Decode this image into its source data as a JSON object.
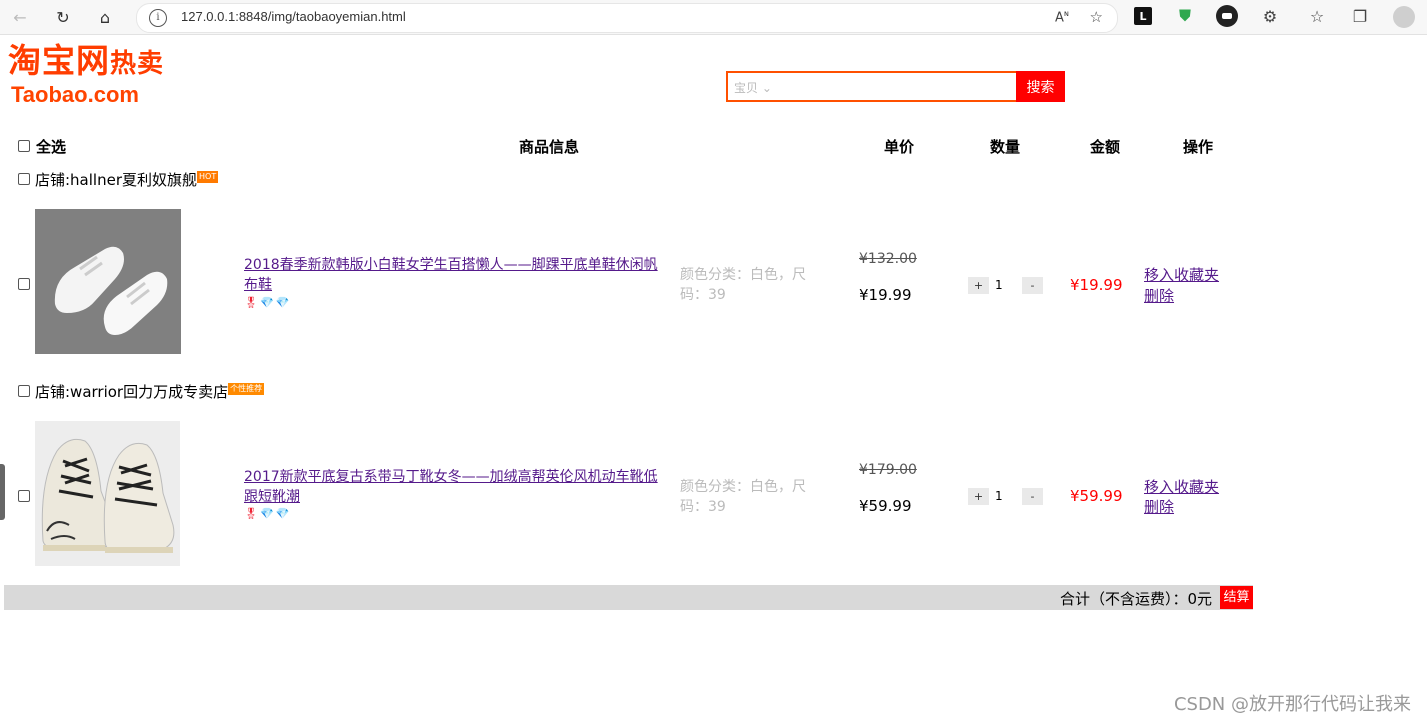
{
  "browser": {
    "url": "127.0.0.1:8848/img/taobaoyemian.html",
    "ext_letter": "L"
  },
  "logo": {
    "cn": "淘宝网",
    "suffix": "热卖",
    "en": "Taobao.com"
  },
  "search": {
    "category": "宝贝",
    "button": "搜索"
  },
  "table_header": {
    "select_all": "全选",
    "info": "商品信息",
    "unit_price": "单价",
    "quantity": "数量",
    "amount": "金额",
    "action": "操作"
  },
  "shops": [
    {
      "name": "店铺:hallner夏利奴旗舰",
      "badge": "HOT",
      "item": {
        "title": "2018春季新款韩版小白鞋女学生百搭懒人——脚踝平底单鞋休闲帆布鞋",
        "spec": "颜色分类：白色，尺码：39",
        "old_price": "¥132.00",
        "price": "¥19.99",
        "qty": "1",
        "amount": "¥19.99",
        "fav": "移入收藏夹",
        "del": "删除"
      }
    },
    {
      "name": "店铺:warrior回力万成专卖店",
      "badge": "个性推荐",
      "item": {
        "title": "2017新款平底复古系带马丁靴女冬——加绒高帮英伦风机动车靴低跟短靴潮",
        "spec": "颜色分类：白色，尺码：39",
        "old_price": "¥179.00",
        "price": "¥59.99",
        "qty": "1",
        "amount": "¥59.99",
        "fav": "移入收藏夹",
        "del": "删除"
      }
    }
  ],
  "qty_buttons": {
    "plus": "+",
    "minus": "-"
  },
  "footer": {
    "total": "合计（不含运费）：0元",
    "checkout": "结算"
  },
  "watermark": "CSDN @放开那行代码让我来"
}
